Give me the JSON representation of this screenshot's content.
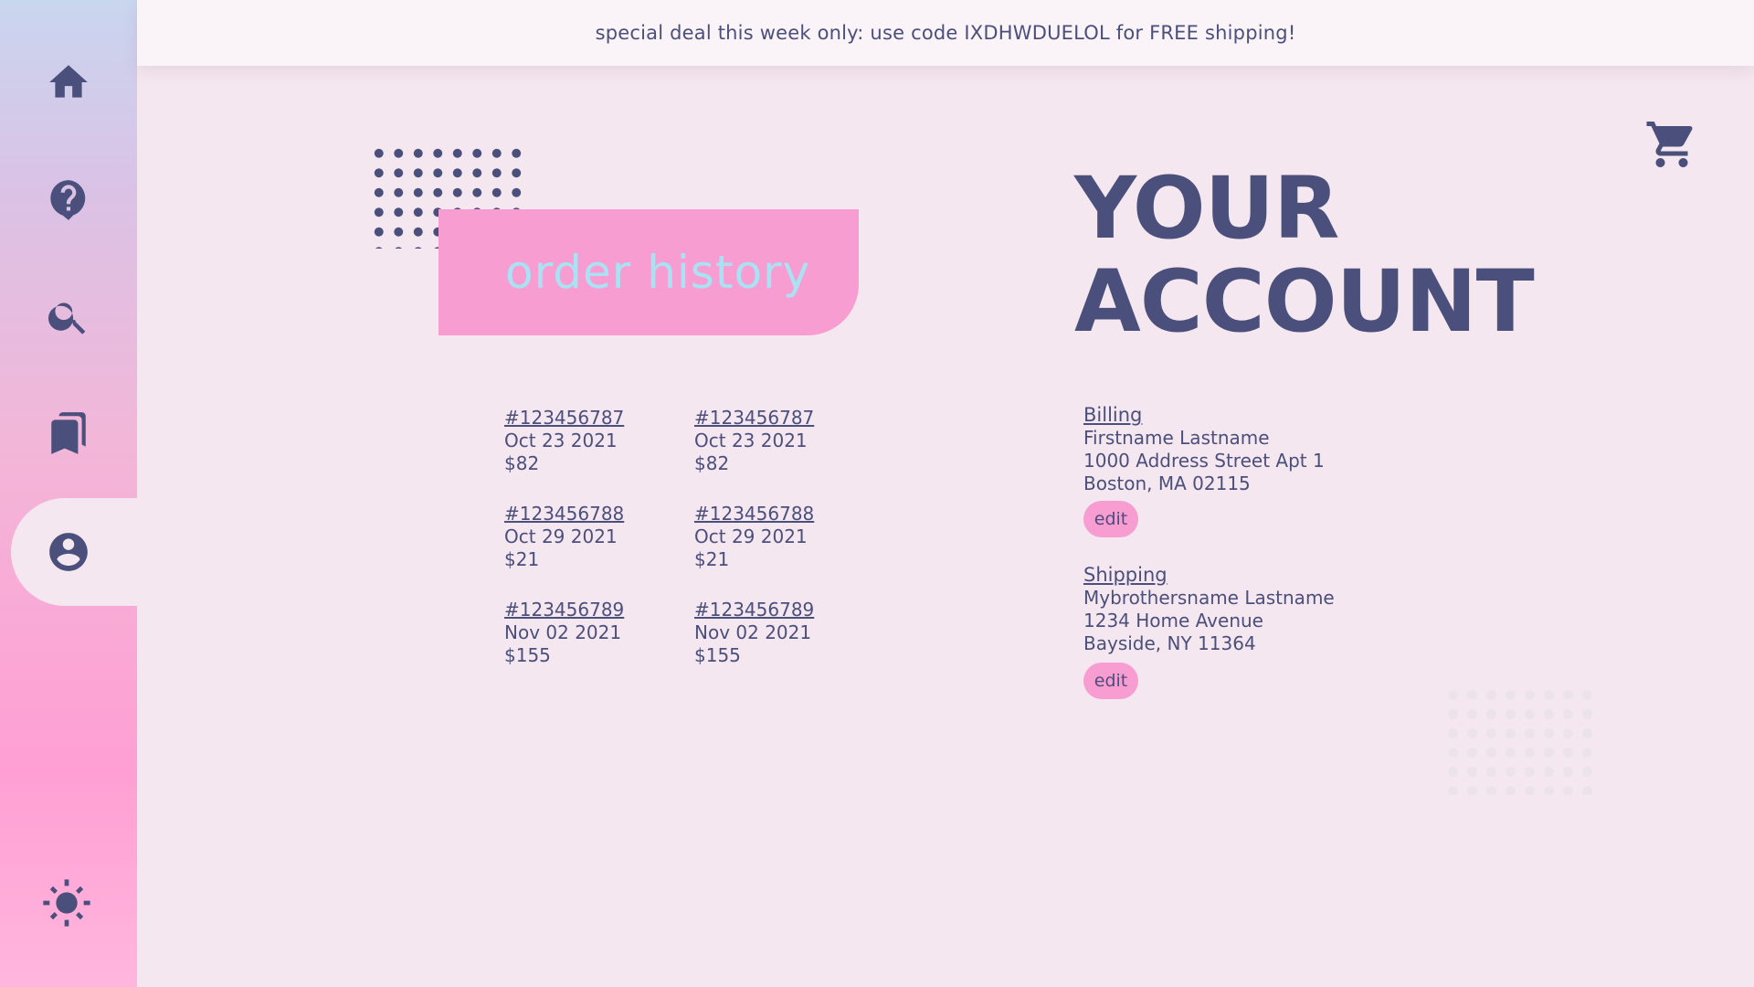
{
  "banner": {
    "text": "special deal this week only: use code IXDHWDUELOL for FREE shipping!"
  },
  "sidebar": {
    "items": [
      {
        "icon": "home-icon"
      },
      {
        "icon": "help-icon"
      },
      {
        "icon": "search-icon"
      },
      {
        "icon": "bookmarks-icon"
      },
      {
        "icon": "account-icon",
        "active": true
      }
    ],
    "theme_icon": "sun-icon"
  },
  "cart_icon": "cart-icon",
  "order_history": {
    "title": "order history",
    "columns": [
      [
        {
          "number": "#123456787",
          "date": "Oct 23 2021",
          "total": "$82"
        },
        {
          "number": "#123456788",
          "date": "Oct 29 2021",
          "total": "$21"
        },
        {
          "number": "#123456789",
          "date": "Nov 02 2021",
          "total": "$155"
        }
      ],
      [
        {
          "number": "#123456787",
          "date": "Oct 23 2021",
          "total": "$82"
        },
        {
          "number": "#123456788",
          "date": "Oct 29 2021",
          "total": "$21"
        },
        {
          "number": "#123456789",
          "date": "Nov 02 2021",
          "total": "$155"
        }
      ]
    ]
  },
  "account": {
    "title_line1": "YOUR",
    "title_line2": "ACCOUNT",
    "billing": {
      "heading": "Billing",
      "name": "Firstname Lastname",
      "street": "1000 Address Street Apt 1",
      "city": "Boston, MA 02115",
      "edit_label": "edit"
    },
    "shipping": {
      "heading": "Shipping",
      "name": "Mybrothersname Lastname",
      "street": "1234 Home Avenue",
      "city": "Bayside, NY 11364",
      "edit_label": "edit"
    }
  },
  "colors": {
    "background": "#f5e7ef",
    "text": "#4b4f7c",
    "accent_pink": "#f89dd2",
    "accent_blue": "#a9e3f3"
  }
}
